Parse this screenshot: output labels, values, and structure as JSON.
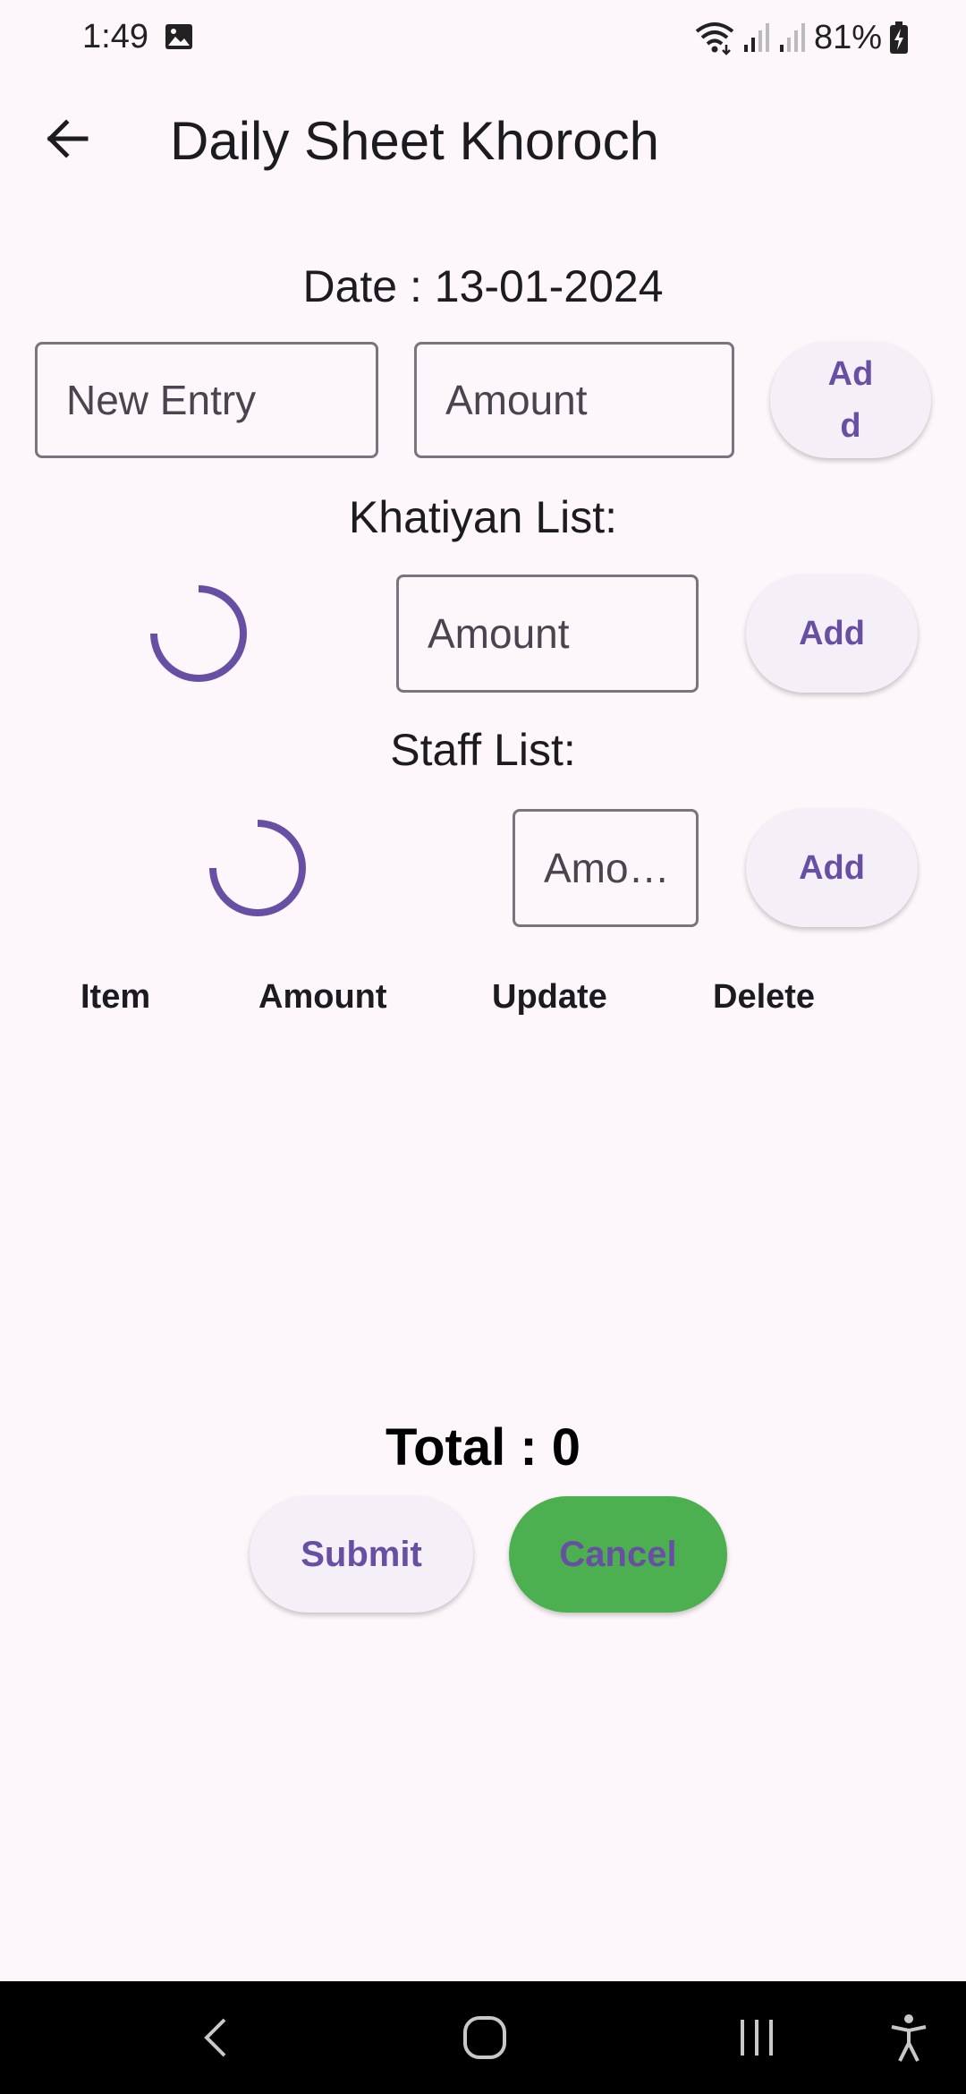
{
  "status_bar": {
    "time": "1:49",
    "battery": "81%"
  },
  "app_bar": {
    "title": "Daily Sheet Khoroch",
    "back_icon": "arrow-back-icon"
  },
  "date_line": "Date : 13-01-2024",
  "new_entry_row": {
    "entry_placeholder": "New Entry",
    "amount_placeholder": "Amount",
    "add_label": "Add"
  },
  "khatiyan": {
    "heading": "Khatiyan List:",
    "amount_placeholder": "Amount",
    "add_label": "Add"
  },
  "staff": {
    "heading": "Staff List:",
    "amount_placeholder": "Amo…",
    "add_label": "Add"
  },
  "table": {
    "columns": [
      "Item",
      "Amount",
      "Update",
      "Delete"
    ]
  },
  "total_line": "Total : 0",
  "actions": {
    "submit_label": "Submit",
    "cancel_label": "Cancel"
  },
  "colors": {
    "accent": "#6750a4",
    "cancel_bg": "#4caf50",
    "background": "#fdf7fb"
  }
}
